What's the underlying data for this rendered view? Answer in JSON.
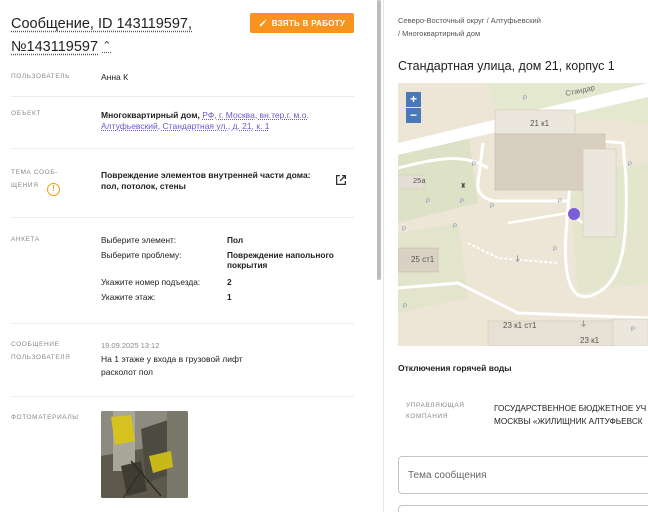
{
  "message": {
    "title": "Сообщение, ID 143119597, №143119597",
    "take_button": "ВЗЯТЬ В РАБОТУ"
  },
  "fields": {
    "user_label": "ПОЛЬЗОВАТЕЛЬ",
    "user_value": "Анна К",
    "object_label": "ОБЪЕКТ",
    "object_type": "Многоквартирный дом,",
    "object_address_line1": "РФ, г. Москва, вн.тер.г. м.о.",
    "object_address_line2": "Алтуфьевский, Стандартная ул., д. 21, к. 1",
    "topic_label_line1": "ТЕМА СООБ-",
    "topic_label_line2": "ЩЕНИЯ",
    "topic_value_line1": "Повреждение элементов внутренней части дома:",
    "topic_value_line2": "пол, потолок, стены"
  },
  "survey": {
    "label": "АНКЕТА",
    "rows": [
      {
        "key": "Выберите элемент:",
        "value": "Пол"
      },
      {
        "key": "Выберите проблему:",
        "value": "Повреждение напольного покрытия"
      },
      {
        "key": "Укажите номер подъезда:",
        "value": "2"
      },
      {
        "key": "Укажите этаж:",
        "value": "1"
      }
    ]
  },
  "user_message": {
    "label_line1": "СООБЩЕНИЕ",
    "label_line2": "ПОЛЬЗОВАТЕЛЯ",
    "date": "19.09.2025 13:12",
    "text_line1": "На 1 этаже у входа в грузовой лифт",
    "text_line2": "расколот пол"
  },
  "photos": {
    "label": "ФОТОМАТЕРИАЛЫ"
  },
  "right": {
    "breadcrumb_line1": "Северо-Восточный округ / Алтуфьевский",
    "breadcrumb_line2": "/ Многоквартирный дом",
    "address_title": "Стандартная улица, дом 21, корпус 1",
    "outage_title": "Отключения горячей воды",
    "mc_label_line1": "УПРАВЛЯЮЩАЯ",
    "mc_label_line2": "КОМПАНИЯ",
    "mc_value_line1": "ГОСУДАРСТВЕННОЕ БЮДЖЕТНОЕ УЧ",
    "mc_value_line2": "МОСКВЫ «ЖИЛИЩНИК АЛТУФЬЕВСК",
    "subject_placeholder": "Тема сообщения"
  },
  "map": {
    "zoom_in": "+",
    "zoom_out": "−",
    "street_label": "Стандар",
    "buildings": [
      "21 к1",
      "25а",
      "25 ст1",
      "23 к1 ст1",
      "23 к1"
    ]
  },
  "colors": {
    "accent": "#f7941d",
    "link": "#6a5acd",
    "warning": "#f39c12",
    "map_zoom": "#4a79b8",
    "map_marker": "#7a5fd6"
  }
}
